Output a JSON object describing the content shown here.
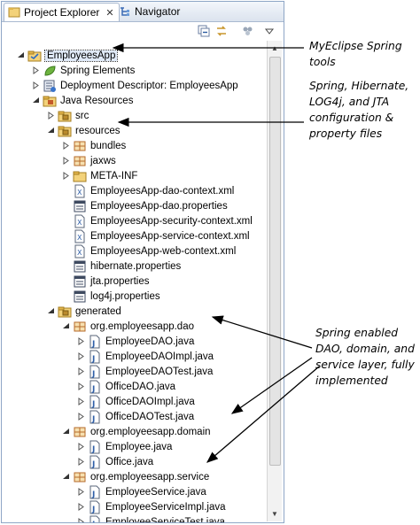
{
  "tabs": {
    "project_explorer": "Project Explorer",
    "navigator": "Navigator"
  },
  "tree": [
    {
      "label": "EmployeesApp",
      "icon": "project-icon",
      "twisty": "open",
      "selected": true
    },
    {
      "label": "Spring Elements",
      "icon": "spring-leaf-icon",
      "twisty": "closed"
    },
    {
      "label": "Deployment Descriptor: EmployeesApp",
      "icon": "deployment-descriptor-icon",
      "twisty": "closed"
    },
    {
      "label": "Java Resources",
      "icon": "java-resources-icon",
      "twisty": "open"
    },
    {
      "label": "src",
      "icon": "source-folder-icon",
      "twisty": "closed"
    },
    {
      "label": "resources",
      "icon": "source-folder-icon",
      "twisty": "open"
    },
    {
      "label": "bundles",
      "icon": "package-icon",
      "twisty": "closed"
    },
    {
      "label": "jaxws",
      "icon": "package-icon",
      "twisty": "closed"
    },
    {
      "label": "META-INF",
      "icon": "folder-icon",
      "twisty": "closed"
    },
    {
      "label": "EmployeesApp-dao-context.xml",
      "icon": "xml-file-icon",
      "twisty": "none"
    },
    {
      "label": "EmployeesApp-dao.properties",
      "icon": "properties-file-icon",
      "twisty": "none"
    },
    {
      "label": "EmployeesApp-security-context.xml",
      "icon": "xml-file-icon",
      "twisty": "none"
    },
    {
      "label": "EmployeesApp-service-context.xml",
      "icon": "xml-file-icon",
      "twisty": "none"
    },
    {
      "label": "EmployeesApp-web-context.xml",
      "icon": "xml-file-icon",
      "twisty": "none"
    },
    {
      "label": "hibernate.properties",
      "icon": "properties-file-icon",
      "twisty": "none"
    },
    {
      "label": "jta.properties",
      "icon": "properties-file-icon",
      "twisty": "none"
    },
    {
      "label": "log4j.properties",
      "icon": "properties-file-icon",
      "twisty": "none"
    },
    {
      "label": "generated",
      "icon": "source-folder-icon",
      "twisty": "open"
    },
    {
      "label": "org.employeesapp.dao",
      "icon": "package-icon",
      "twisty": "open"
    },
    {
      "label": "EmployeeDAO.java",
      "icon": "java-file-icon",
      "twisty": "closed"
    },
    {
      "label": "EmployeeDAOImpl.java",
      "icon": "java-file-icon",
      "twisty": "closed"
    },
    {
      "label": "EmployeeDAOTest.java",
      "icon": "java-file-icon",
      "twisty": "closed"
    },
    {
      "label": "OfficeDAO.java",
      "icon": "java-file-icon",
      "twisty": "closed"
    },
    {
      "label": "OfficeDAOImpl.java",
      "icon": "java-file-icon",
      "twisty": "closed"
    },
    {
      "label": "OfficeDAOTest.java",
      "icon": "java-file-icon",
      "twisty": "closed"
    },
    {
      "label": "org.employeesapp.domain",
      "icon": "package-icon",
      "twisty": "open"
    },
    {
      "label": "Employee.java",
      "icon": "java-file-icon",
      "twisty": "closed"
    },
    {
      "label": "Office.java",
      "icon": "java-file-icon",
      "twisty": "closed"
    },
    {
      "label": "org.employeesapp.service",
      "icon": "package-icon",
      "twisty": "open"
    },
    {
      "label": "EmployeeService.java",
      "icon": "java-file-icon",
      "twisty": "closed"
    },
    {
      "label": "EmployeeServiceImpl.java",
      "icon": "java-file-icon",
      "twisty": "closed"
    },
    {
      "label": "EmployeeServiceTest.java",
      "icon": "java-file-icon",
      "twisty": "closed"
    }
  ],
  "annotations": {
    "myeclipse": "MyEclipse Spring tools",
    "config_lines": [
      "Spring, Hibernate,",
      "LOG4j, and JTA",
      "configuration &",
      "property files"
    ],
    "layer_lines": [
      "Spring enabled",
      "DAO, domain, and",
      "service layer, fully",
      "implemented"
    ]
  }
}
